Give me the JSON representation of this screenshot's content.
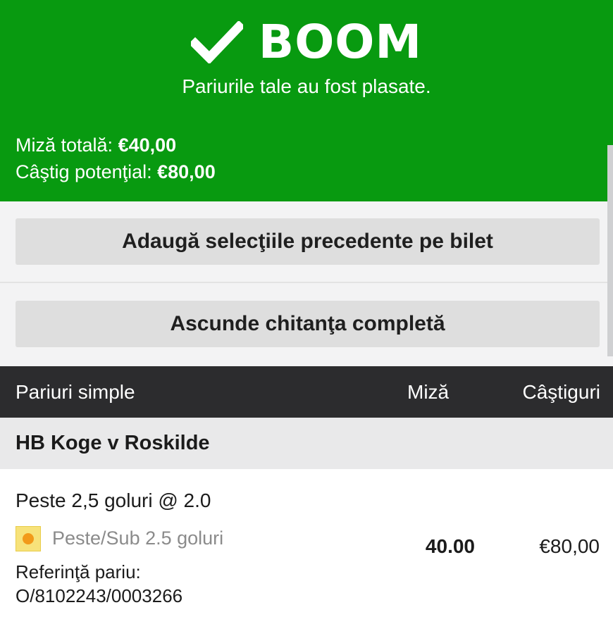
{
  "header": {
    "title": "BOOM",
    "subtitle": "Pariurile tale au fost plasate.",
    "colors": {
      "banner": "#089a10",
      "text": "#ffffff"
    },
    "total_stake_label": "Miză totală: ",
    "total_stake_value": "€40,00",
    "potential_win_label": "Câştig potenţial: ",
    "potential_win_value": "€80,00"
  },
  "actions": {
    "add_previous_label": "Adaugă selecţiile precedente pe bilet",
    "hide_receipt_label": "Ascunde chitanţa completă"
  },
  "table": {
    "columns": [
      "Pariuri simple",
      "Miză",
      "Câştiguri"
    ],
    "colors": {
      "header_bg": "#2c2c2e",
      "event_bg": "#e9e9ea"
    }
  },
  "bets": [
    {
      "event": "HB Koge v Roskilde",
      "selection": "Peste 2,5 goluri @ 2.0",
      "market": "Peste/Sub 2.5 goluri",
      "market_icon": "status-dot-icon",
      "reference_label": "Referinţă pariu:",
      "reference_value": "O/8102243/0003266",
      "stake": "40.00",
      "winnings": "€80,00"
    }
  ]
}
